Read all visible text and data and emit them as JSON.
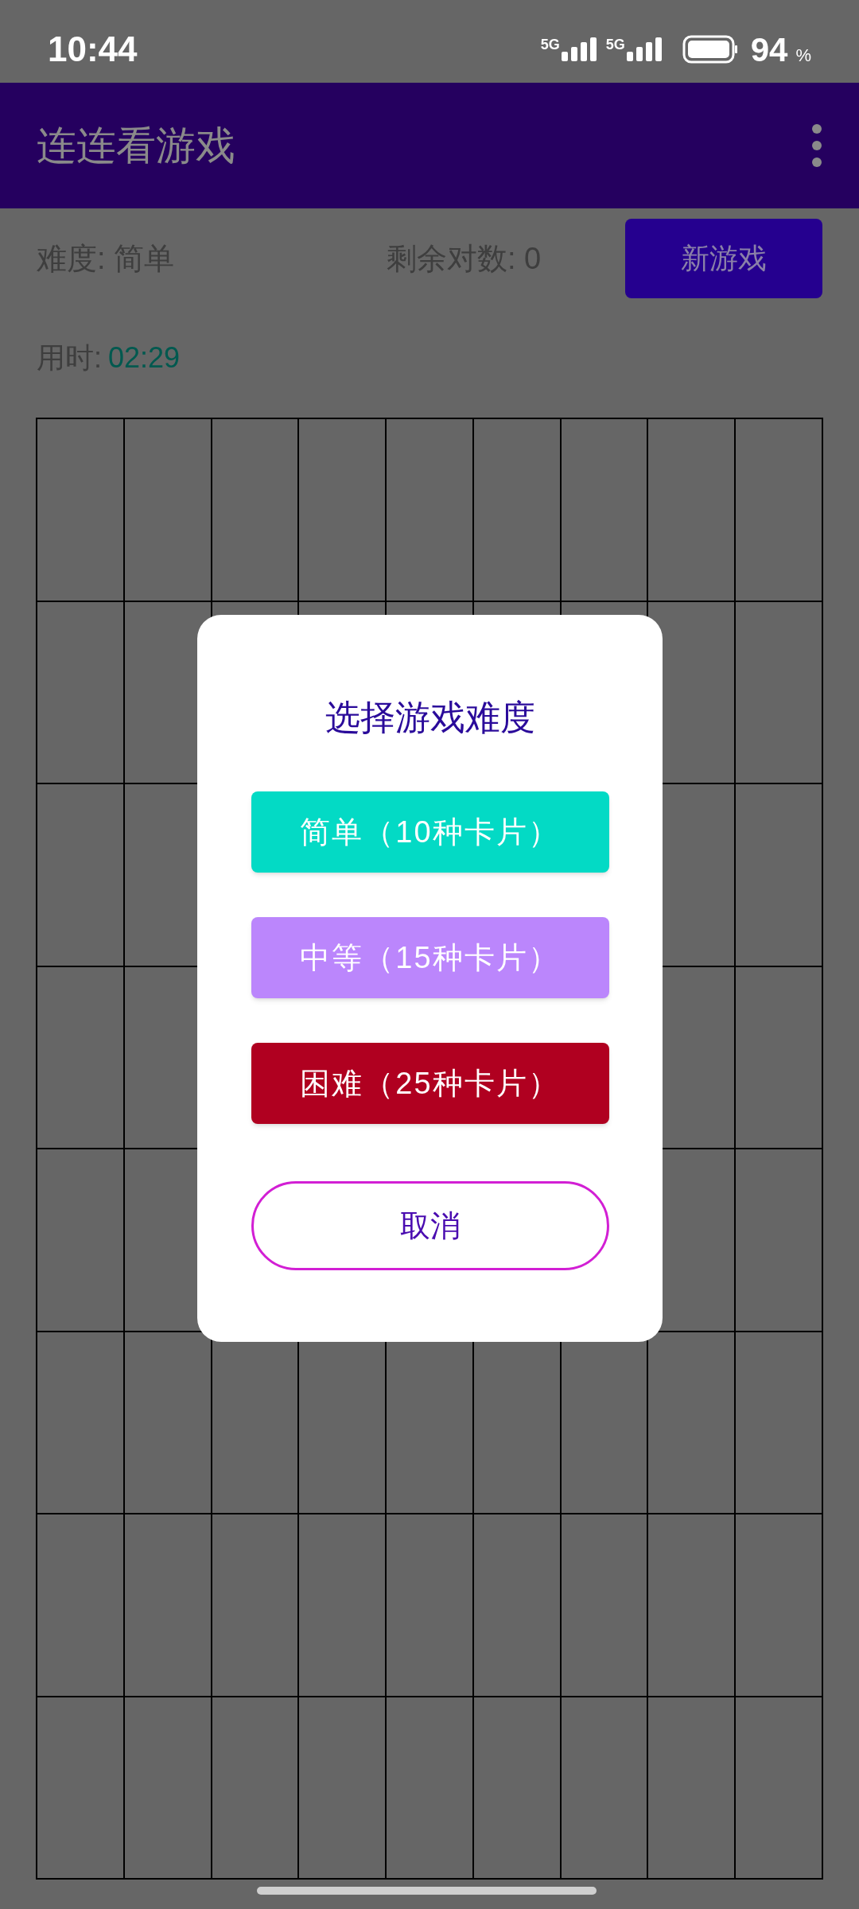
{
  "status_bar": {
    "time": "10:44",
    "networks": [
      "5G",
      "5G"
    ],
    "battery": "94",
    "battery_unit": "%"
  },
  "app_bar": {
    "title": "连连看游戏"
  },
  "info": {
    "difficulty": "难度: 简单",
    "remaining": "剩余对数: 0",
    "new_game": "新游戏",
    "timer_label": "用时:",
    "timer_value": "02:29"
  },
  "dialog": {
    "title": "选择游戏难度",
    "options": [
      {
        "label": "简单（10种卡片）",
        "color": "#03dac5"
      },
      {
        "label": "中等（15种卡片）",
        "color": "#bb86fc"
      },
      {
        "label": "困难（25种卡片）",
        "color": "#b00020"
      }
    ],
    "cancel": "取消"
  }
}
